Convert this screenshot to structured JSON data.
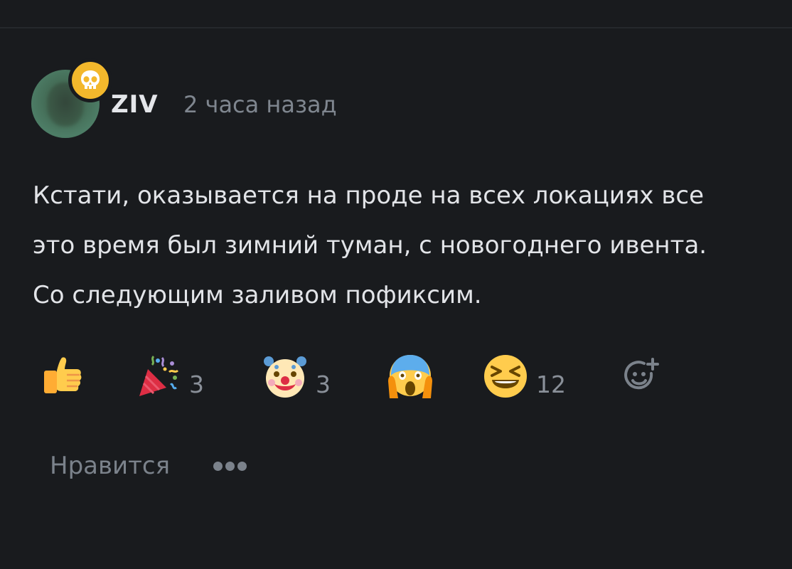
{
  "comment": {
    "author": "ZIV",
    "time": "2 часа назад",
    "badge_icon": "skull-icon",
    "text_lines": [
      "Кстати, оказывается на проде на всех локациях все",
      "это время был зимний туман, с новогоднего ивента.",
      "Со следующим заливом пофиксим."
    ]
  },
  "reactions": [
    {
      "icon": "thumbs-up-icon",
      "count": ""
    },
    {
      "icon": "party-popper-icon",
      "count": "3"
    },
    {
      "icon": "clown-face-icon",
      "count": "3"
    },
    {
      "icon": "screaming-face-icon",
      "count": ""
    },
    {
      "icon": "laughing-face-icon",
      "count": "12"
    },
    {
      "icon": "add-reaction-icon",
      "count": ""
    }
  ],
  "actions": {
    "like_label": "Нравится",
    "more_icon": "more-dots-icon"
  },
  "colors": {
    "background": "#191b1e",
    "text": "#e2e4e8",
    "muted": "#7f868f",
    "badge": "#f3b82c"
  }
}
